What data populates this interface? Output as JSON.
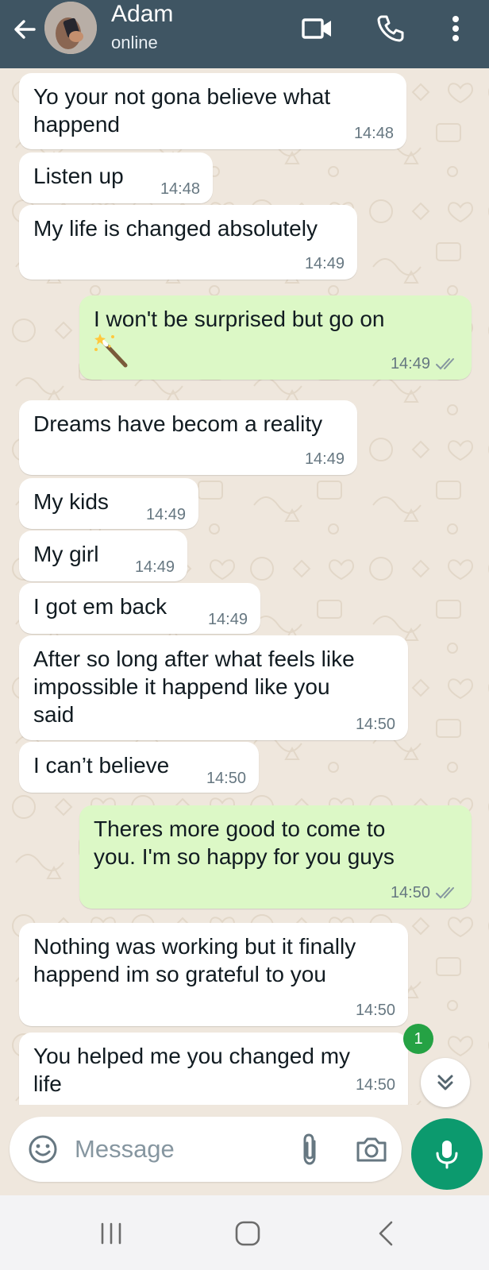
{
  "header": {
    "contact_name": "Adam",
    "contact_status": "online",
    "icons": [
      "back-arrow-icon",
      "video-call-icon",
      "voice-call-icon",
      "more-options-icon"
    ],
    "bg_color": "#3f5563"
  },
  "messages": [
    {
      "dir": "in",
      "text": "Yo your not gona believe what\nhappend",
      "time": "14:48"
    },
    {
      "dir": "in",
      "text": "Listen up",
      "time": "14:48"
    },
    {
      "dir": "in",
      "text": "My life is changed absolutely",
      "time": "14:49"
    },
    {
      "dir": "out",
      "text": "I won't be surprised but go on",
      "emoji": "magic-wand-emoji",
      "time": "14:49",
      "status": "read"
    },
    {
      "dir": "in",
      "text": "Dreams have becom a reality",
      "time": "14:49"
    },
    {
      "dir": "in",
      "text": "My kids",
      "time": "14:49"
    },
    {
      "dir": "in",
      "text": "My girl",
      "time": "14:49"
    },
    {
      "dir": "in",
      "text": "I got em back",
      "time": "14:49"
    },
    {
      "dir": "in",
      "text": "After so long after what feels like\nimpossible it happend like you\nsaid",
      "time": "14:50"
    },
    {
      "dir": "in",
      "text": "I can’t believe",
      "time": "14:50"
    },
    {
      "dir": "out",
      "text": "Theres more good to come to\nyou. I'm so happy for you guys",
      "time": "14:50",
      "status": "read"
    },
    {
      "dir": "in",
      "text": "Nothing was working but it finally\nhappend im so grateful to you",
      "time": "14:50"
    },
    {
      "dir": "in",
      "text": "You helped me you changed my\nlife",
      "time": "14:50"
    }
  ],
  "unread_count": "1",
  "composer": {
    "placeholder": "Message",
    "icons": [
      "emoji-icon",
      "attach-icon",
      "camera-icon",
      "mic-icon"
    ],
    "mic_color": "#0c9a6e"
  },
  "navbar": {
    "icons": [
      "recent-apps-icon",
      "home-icon",
      "back-icon"
    ]
  },
  "colors": {
    "incoming_bubble": "#ffffff",
    "outgoing_bubble": "#dcf8c6",
    "chat_background": "#efe7dd",
    "read_receipt": "#8696a0"
  }
}
